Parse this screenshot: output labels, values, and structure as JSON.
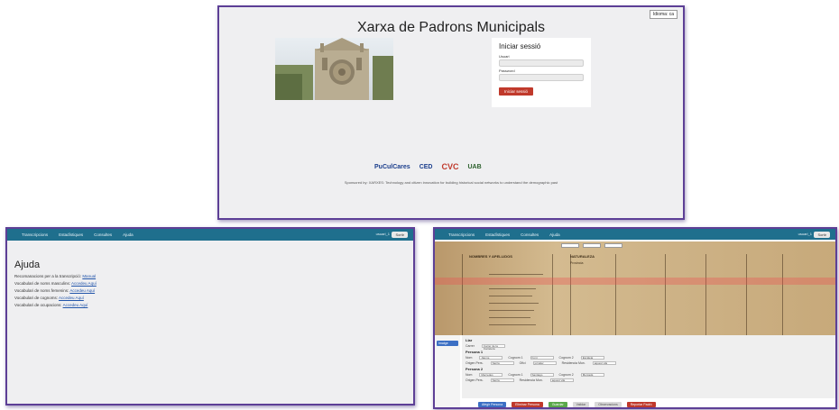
{
  "login": {
    "language_select": "Idioma: ca",
    "title": "Xarxa de Padrons Municipals",
    "card_title": "Iniciar sessió",
    "user_label": "Usuari",
    "password_label": "Password",
    "submit_label": "Iniciar sessió",
    "logos": [
      "PuCulCares",
      "CED",
      "CVC",
      "UAB"
    ],
    "sponsor_text": "Sponsored by: XARXES: Technology and citizen innovation for building historical social networks to understand the demographic past"
  },
  "help": {
    "nav": [
      "Transcripcions",
      "Estadístiques",
      "Consultes",
      "Ajuda"
    ],
    "user": "usuari_1",
    "logout": "Sortir",
    "title": "Ajuda",
    "lines": [
      {
        "text": "Recomanacions per a la transcripció:",
        "link": "Manual"
      },
      {
        "text": "Vocabulari de noms masculins:",
        "link": "Accedeu Aquí"
      },
      {
        "text": "Vocabulari de noms femenins:",
        "link": "Accedeu Aquí"
      },
      {
        "text": "Vocabulari de cognoms:",
        "link": "Accedeu Aquí"
      },
      {
        "text": "Vocabulari de ocupacions:",
        "link": "Accedeu Aquí"
      }
    ]
  },
  "transcription": {
    "nav": [
      "Transcripcions",
      "Estadístiques",
      "Consultes",
      "Ajuda"
    ],
    "user": "usuari_1",
    "logout": "Sortir",
    "doc_headers": [
      "NOMBRES Y APELLIDOS",
      "NATURALEZA",
      "Provincia"
    ],
    "side_button": "Imatge",
    "form": {
      "section_llar": "Llar",
      "carrer_label": "Carrer",
      "carrer_value": "Carrer de la Carretera",
      "persona1": "Persona 1",
      "persona2": "Persona 2",
      "nom_label": "Nom",
      "p1_nom": "Jaume",
      "p1_cognom1": "Font",
      "p1_cognom2": "Escaleta",
      "p2_nom": "Mercedes",
      "p2_cognom1": "Santiago",
      "p2_cognom2": "Mercadé",
      "cognom1_label": "Cognom 1",
      "cognom2_label": "Cognom 2",
      "origen_label": "Origen Pers.",
      "p1_origen": "Sarria",
      "p2_origen": "Sarria",
      "ofici_label": "Ofici",
      "p1_ofici": "jornaler",
      "residencia_label": "Residencia Mun.",
      "p1_residencia": "aquest vila",
      "p2_residencia": "aquest vila"
    },
    "buttons": [
      {
        "label": "Afegir Persona",
        "color": "#3b6fc4"
      },
      {
        "label": "Eliminar Persona",
        "color": "#c0392b"
      },
      {
        "label": "Guardar",
        "color": "#5aa84b"
      },
      {
        "label": "Validar",
        "color": "#d9d9d9"
      },
      {
        "label": "Observacions",
        "color": "#d9d9d9"
      },
      {
        "label": "Reportar Padró",
        "color": "#c0392b"
      }
    ]
  }
}
